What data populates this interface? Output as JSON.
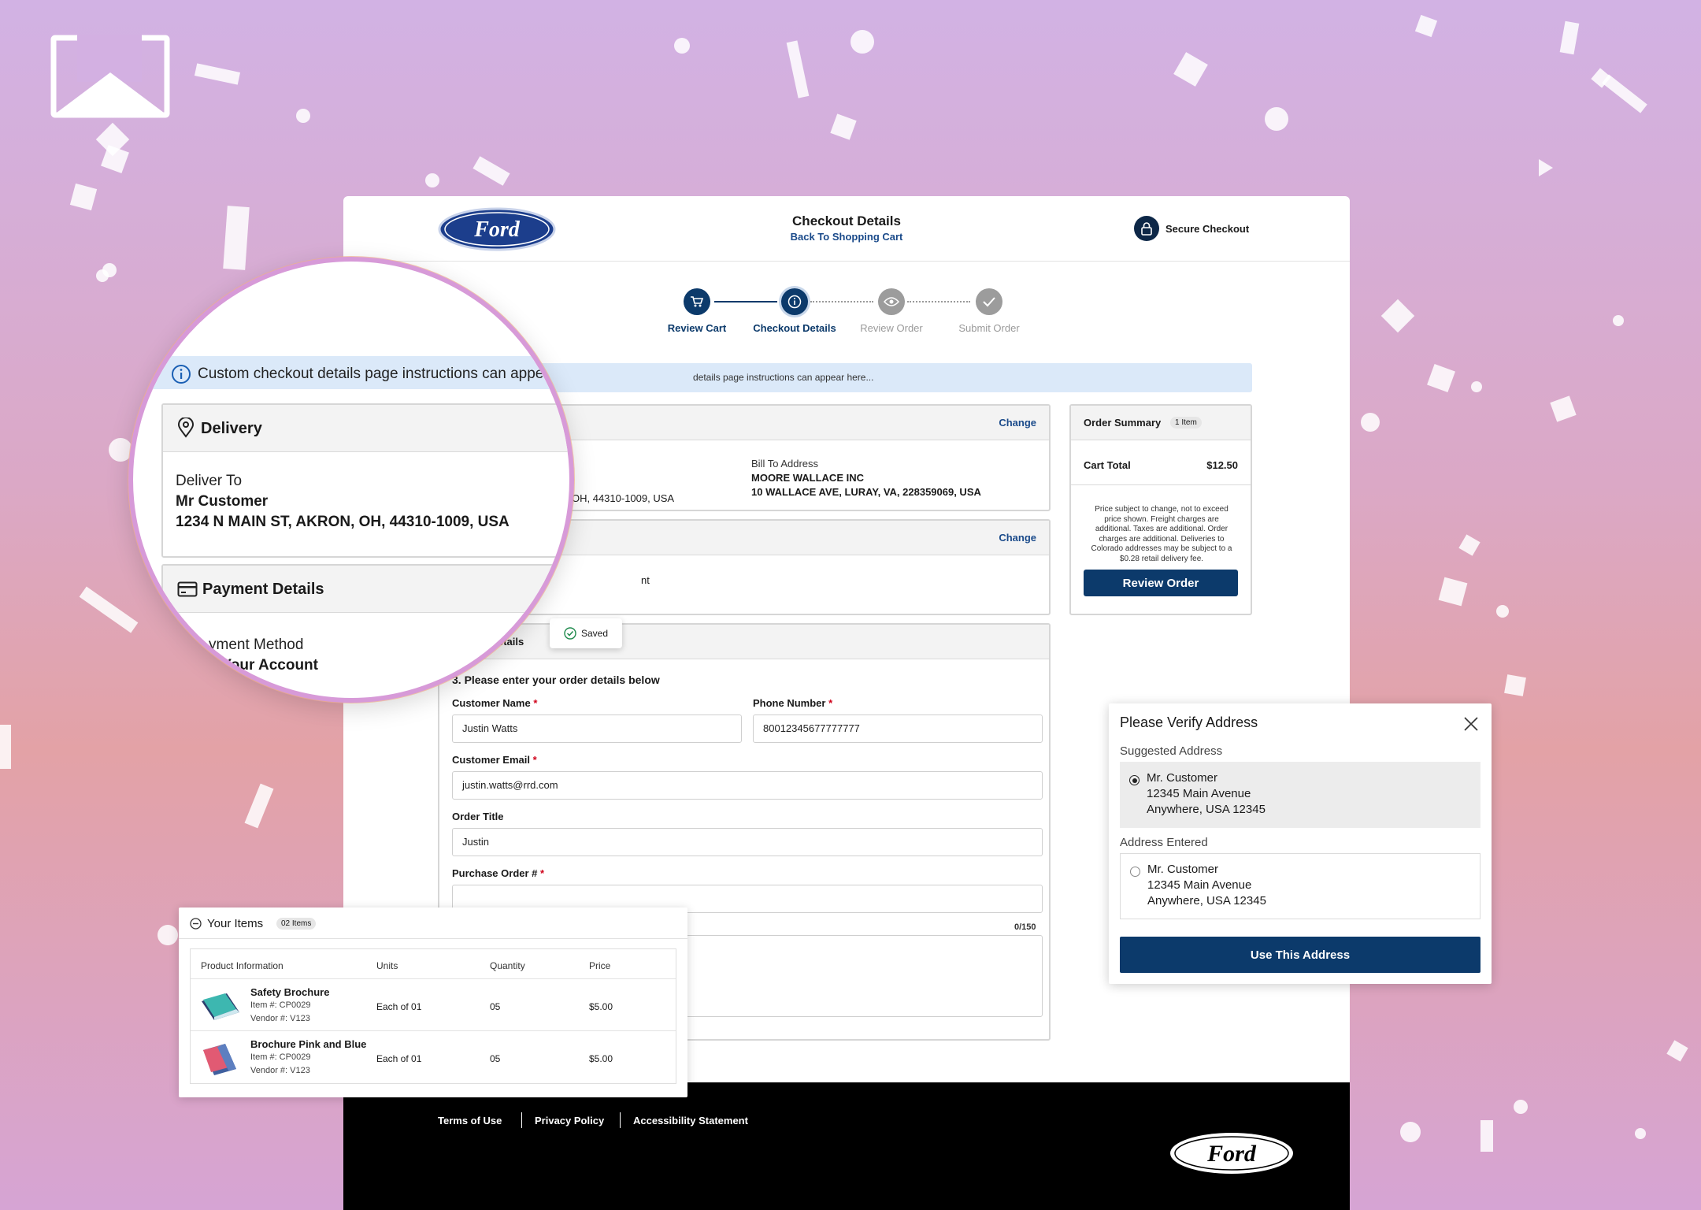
{
  "header": {
    "title": "Checkout Details",
    "back_link": "Back To Shopping Cart",
    "secure_label": "Secure Checkout",
    "brand": "Ford"
  },
  "steps": [
    {
      "label": "Review Cart",
      "icon": "cart-icon"
    },
    {
      "label": "Checkout Details",
      "icon": "info-icon"
    },
    {
      "label": "Review Order",
      "icon": "eye-icon"
    },
    {
      "label": "Submit Order",
      "icon": "check-icon"
    }
  ],
  "banner": {
    "text": "details page instructions can appear here..."
  },
  "delivery": {
    "change": "Change",
    "bill_label": "Bill To Address",
    "bill_name": "MOORE WALLACE INC",
    "bill_address": "10 WALLACE AVE, LURAY, VA, 228359069, USA",
    "ship_partial": "OH, 44310-1009, USA"
  },
  "payment": {
    "change": "Change",
    "partial": "nt"
  },
  "order_details": {
    "header_partial": "etails",
    "saved": "Saved",
    "prompt": "3. Please enter your order details below",
    "customer_name_label": "Customer Name",
    "customer_name": "Justin Watts",
    "phone_label": "Phone Number",
    "phone": "80012345677777777",
    "email_label": "Customer Email",
    "email": "justin.watts@rrd.com",
    "title_label": "Order Title",
    "title": "Justin",
    "po_label": "Purchase Order #",
    "po": "",
    "counter": "0/150"
  },
  "summary": {
    "title": "Order Summary",
    "count": "1 Item",
    "cart_total_label": "Cart Total",
    "cart_total": "$12.50",
    "note": "Price subject to change, not to exceed price shown. Freight charges are additional. Taxes are additional. Order charges are additional. Deliveries to Colorado addresses may be subject to a $0.28 retail delivery fee.",
    "button": "Review Order"
  },
  "items": {
    "title": "Your Items",
    "count": "02 Items",
    "columns": [
      "Product Information",
      "Units",
      "Quantity",
      "Price"
    ],
    "rows": [
      {
        "name": "Safety Brochure",
        "item": "Item #: CP0029",
        "vendor": "Vendor #: V123",
        "units": "Each of 01",
        "qty": "05",
        "price": "$5.00"
      },
      {
        "name": "Brochure Pink and Blue",
        "item": "Item #: CP0029",
        "vendor": "Vendor #: V123",
        "units": "Each of 01",
        "qty": "05",
        "price": "$5.00"
      }
    ]
  },
  "verify": {
    "title": "Please Verify Address",
    "suggested_label": "Suggested Address",
    "suggested": [
      "Mr. Customer",
      "12345 Main Avenue",
      "Anywhere, USA 12345"
    ],
    "entered_label": "Address Entered",
    "entered": [
      "Mr. Customer",
      "12345 Main Avenue",
      "Anywhere, USA 12345"
    ],
    "button": "Use This Address"
  },
  "magnifier": {
    "instructions": "Custom checkout details page instructions can appear",
    "delivery_title": "Delivery",
    "deliver_to": "Deliver To",
    "customer": "Mr Customer",
    "address": "1234 N MAIN ST, AKRON, OH, 44310-1009, USA",
    "payment_title": "Payment Details",
    "method": "yment Method",
    "account": "o Your Account"
  },
  "footer": {
    "links": [
      "Terms of Use",
      "Privacy Policy",
      "Accessibility Statement"
    ]
  }
}
